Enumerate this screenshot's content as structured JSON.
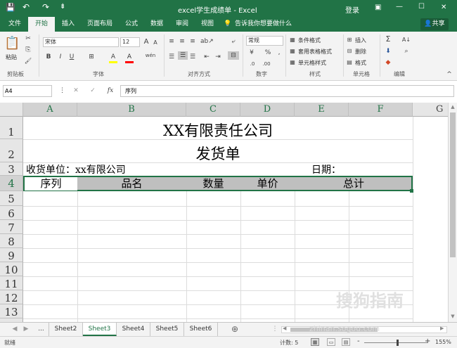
{
  "window": {
    "title": "excel学生成绩单  -  Excel",
    "account": "登录",
    "controls": {
      "ribbon_options": "▣",
      "minimize": "—",
      "maximize": "☐",
      "close": "✕"
    },
    "qat": {
      "save": "💾",
      "undo": "↶",
      "redo": "↷",
      "customize": "⇟"
    }
  },
  "tabs": [
    "文件",
    "开始",
    "插入",
    "页面布局",
    "公式",
    "数据",
    "审阅",
    "视图"
  ],
  "tell_me": "告诉我你想要做什么",
  "share": "共享",
  "ribbon": {
    "clipboard": {
      "paste": "粘贴",
      "label": "剪贴板",
      "cut": "✂",
      "copy": "⎘",
      "format_painter": "🖌"
    },
    "font": {
      "name": "宋体",
      "size": "12",
      "grow": "A",
      "shrink": "A",
      "bold": "B",
      "italic": "I",
      "underline": "U",
      "border": "⊞",
      "fill": "A",
      "color": "A",
      "phonetic": "wén",
      "label": "字体"
    },
    "alignment": {
      "label": "对齐方式",
      "wrap": "⤶",
      "merge": "⊟"
    },
    "number": {
      "format": "常规",
      "currency": "¥",
      "percent": "%",
      "comma": ",",
      "label": "数字"
    },
    "styles": {
      "conditional": "条件格式",
      "as_table": "套用表格格式",
      "cell_styles": "单元格样式",
      "label": "样式"
    },
    "cells": {
      "insert": "插入",
      "delete": "删除",
      "format": "格式",
      "label": "单元格"
    },
    "editing": {
      "autosum": "Σ",
      "sort": "A↓",
      "find": "⌕",
      "fill": "⬇",
      "clear": "◆",
      "label": "编辑"
    }
  },
  "formula_bar": {
    "name_box": "A4",
    "cancel": "✕",
    "enter": "✓",
    "fx": "fx",
    "content": "序列"
  },
  "columns": [
    "A",
    "B",
    "C",
    "D",
    "E",
    "F",
    "G"
  ],
  "rows": [
    "1",
    "2",
    "3",
    "4",
    "5",
    "6",
    "7",
    "8",
    "9",
    "10",
    "11",
    "12",
    "13"
  ],
  "cells": {
    "title": "XX有限责任公司",
    "subtitle": "发货单",
    "receiver": "收货单位：xx有限公司",
    "date": "日期：",
    "headers": [
      "序列",
      "品名",
      "数量",
      "单价",
      "总计"
    ]
  },
  "sheets": [
    "Sheet2",
    "Sheet3",
    "Sheet4",
    "Sheet5",
    "Sheet6"
  ],
  "active_sheet": "Sheet3",
  "sheet_nav": {
    "prev": "◀",
    "next": "▶",
    "more": "...",
    "add": "⊕"
  },
  "status": {
    "mode": "就绪",
    "count": "计数: 5",
    "zoom": "155%",
    "zoom_minus": "-",
    "zoom_plus": "+"
  },
  "watermark": "搜狗指南",
  "watermark_url": "zhinan.sogou.com",
  "colors": {
    "accent": "#217346",
    "header_fill": "#bfbfbf"
  }
}
